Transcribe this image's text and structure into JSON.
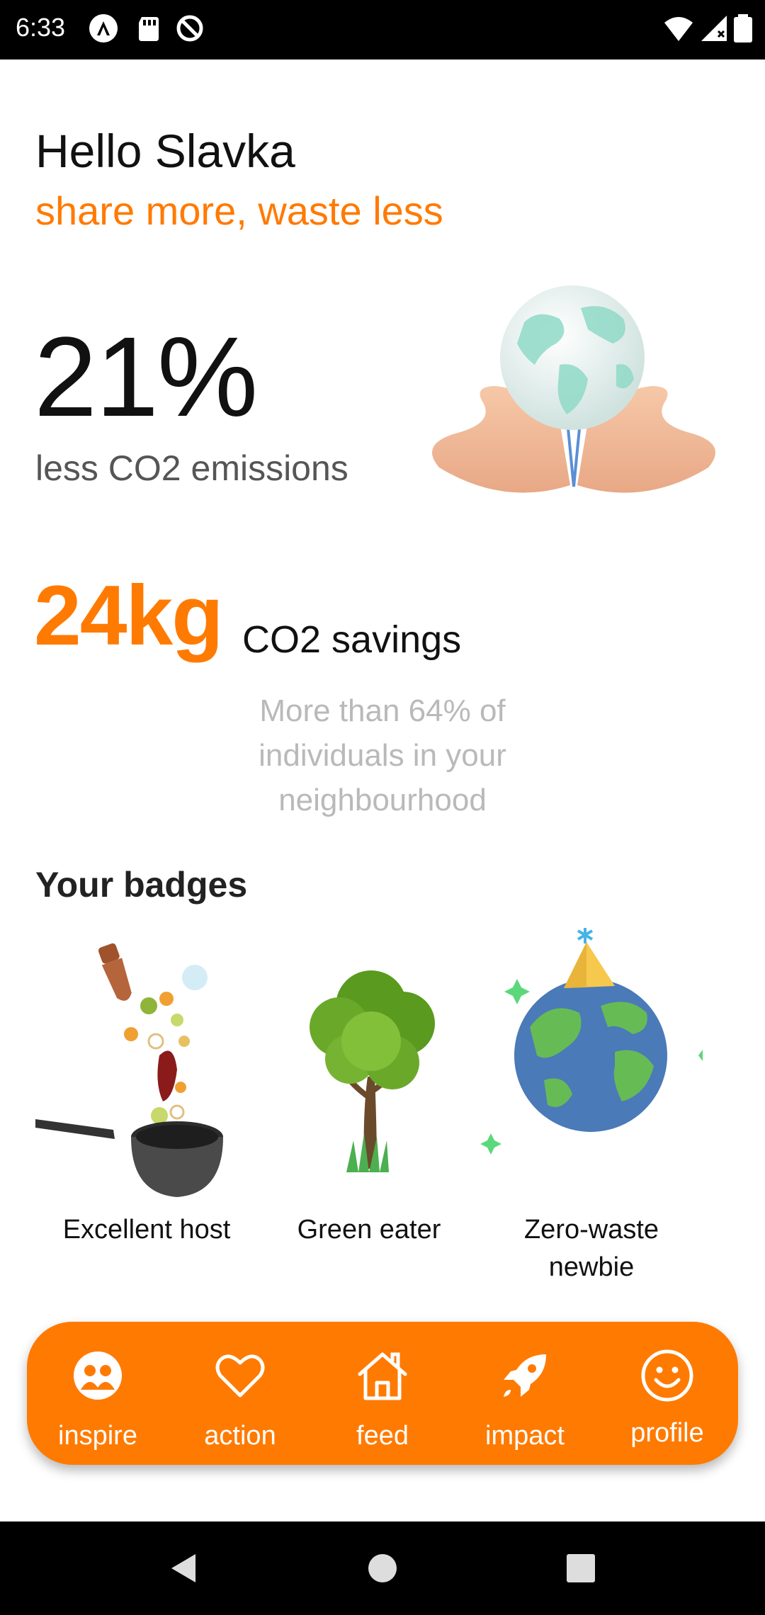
{
  "status_bar": {
    "time": "6:33",
    "left_icons": [
      "a-logo-icon",
      "sd-card-icon",
      "no-sync-icon"
    ],
    "right_icons": [
      "wifi-icon",
      "signal-icon",
      "battery-icon"
    ]
  },
  "header": {
    "greeting": "Hello Slavka",
    "tagline": "share more, waste less"
  },
  "impact": {
    "percent": "21%",
    "percent_label": "less CO2 emissions",
    "illustration": "globe-in-hands-icon"
  },
  "savings": {
    "amount": "24kg",
    "label": "CO2 savings",
    "note": "More than 64% of individuals in your neighbourhood"
  },
  "badges": {
    "title": "Your badges",
    "items": [
      {
        "label": "Excellent host",
        "icon": "cooking-pot-icon"
      },
      {
        "label": "Green eater",
        "icon": "tree-icon"
      },
      {
        "label": "Zero-waste newbie",
        "icon": "party-globe-icon"
      }
    ]
  },
  "tabbar": {
    "tabs": [
      {
        "label": "inspire",
        "icon": "people-icon"
      },
      {
        "label": "action",
        "icon": "heart-icon"
      },
      {
        "label": "feed",
        "icon": "home-icon"
      },
      {
        "label": "impact",
        "icon": "rocket-icon"
      },
      {
        "label": "profile",
        "icon": "smile-icon"
      }
    ],
    "color": "#ff7a00"
  },
  "colors": {
    "accent": "#ff7a00",
    "text": "#111111",
    "muted": "#b9b9b9"
  }
}
